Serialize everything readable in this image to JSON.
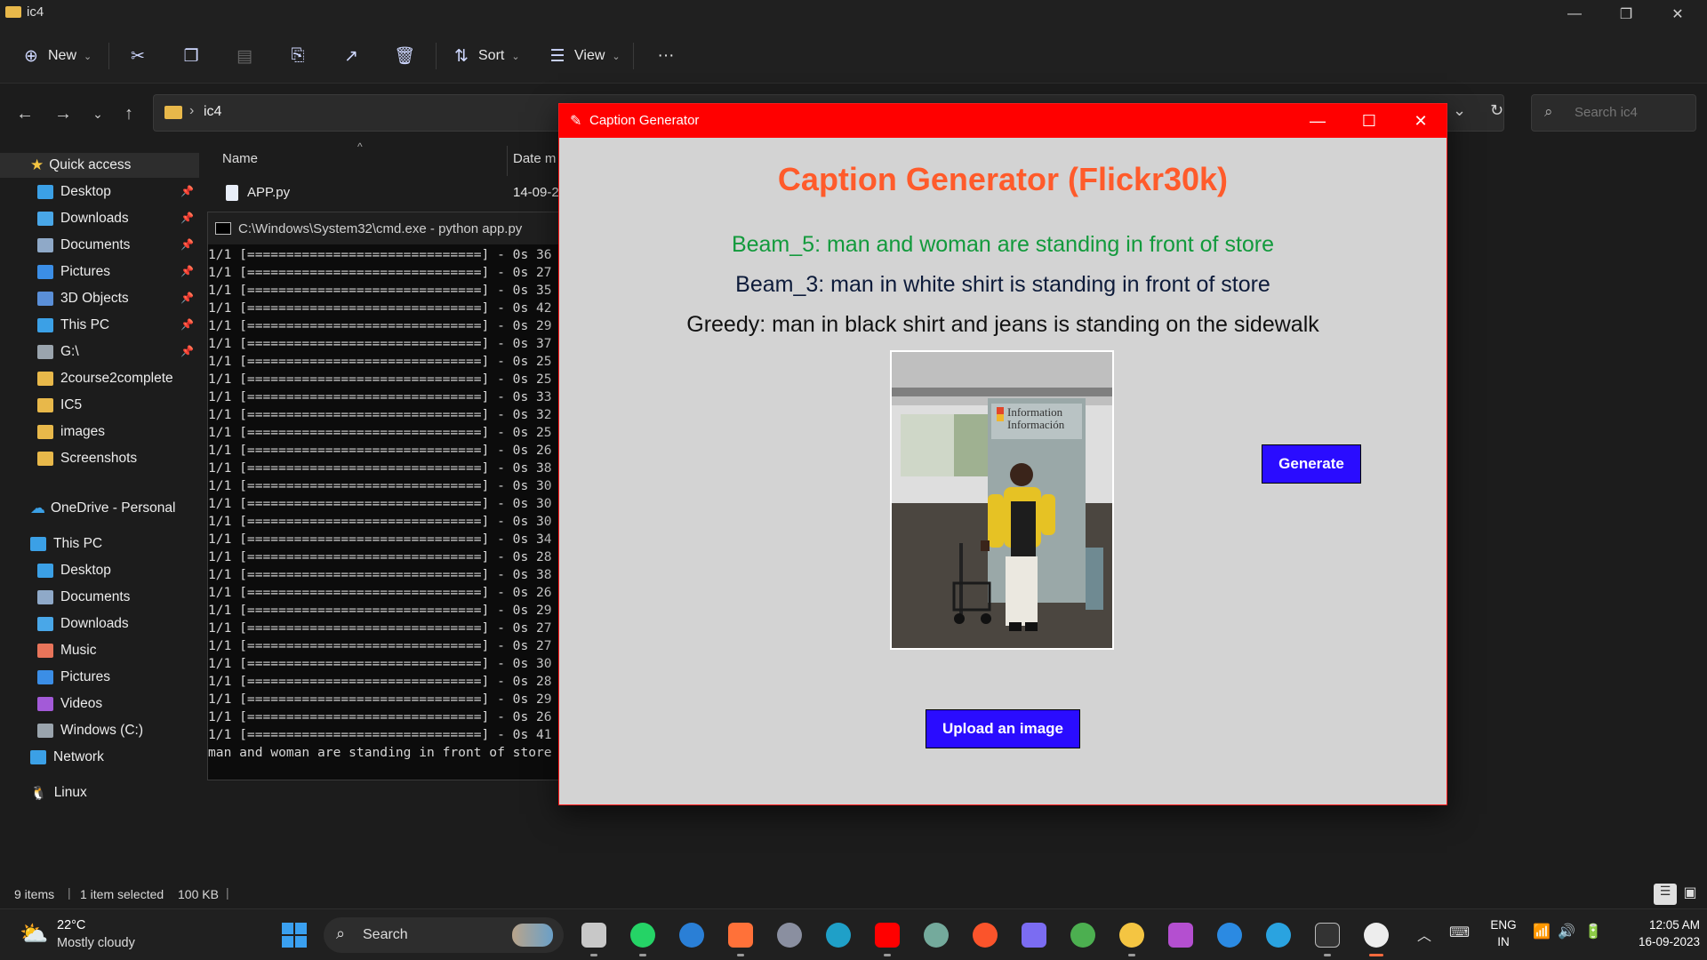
{
  "explorer": {
    "window_title": "ic4",
    "toolbar": {
      "new_label": "New",
      "sort_label": "Sort",
      "view_label": "View"
    },
    "address": {
      "path": "ic4",
      "search_placeholder": "Search ic4"
    },
    "sidebar": {
      "quick_access": "Quick access",
      "items": [
        {
          "label": "Desktop",
          "icon": "desktop-icon",
          "color": "#3ba0e6"
        },
        {
          "label": "Downloads",
          "icon": "download-icon",
          "color": "#49a7e8"
        },
        {
          "label": "Documents",
          "icon": "documents-icon",
          "color": "#8fa9c8"
        },
        {
          "label": "Pictures",
          "icon": "pictures-icon",
          "color": "#3b8ee6"
        },
        {
          "label": "3D Objects",
          "icon": "3d-objects-icon",
          "color": "#5a8fd8"
        },
        {
          "label": "This PC",
          "icon": "pc-icon",
          "color": "#3ba0e6"
        },
        {
          "label": "G:\\",
          "icon": "drive-icon",
          "color": "#9aa4ad"
        },
        {
          "label": "2course2complete",
          "icon": "folder-icon",
          "color": "#e8b84a"
        },
        {
          "label": "IC5",
          "icon": "folder-icon",
          "color": "#e8b84a"
        },
        {
          "label": "images",
          "icon": "folder-icon",
          "color": "#e8b84a"
        },
        {
          "label": "Screenshots",
          "icon": "folder-icon",
          "color": "#e8b84a"
        }
      ],
      "onedrive": "OneDrive - Personal",
      "this_pc": "This PC",
      "pc_items": [
        {
          "label": "Desktop",
          "icon": "desktop-icon",
          "color": "#3ba0e6"
        },
        {
          "label": "Documents",
          "icon": "documents-icon",
          "color": "#8fa9c8"
        },
        {
          "label": "Downloads",
          "icon": "download-icon",
          "color": "#49a7e8"
        },
        {
          "label": "Music",
          "icon": "music-icon",
          "color": "#e8745a"
        },
        {
          "label": "Pictures",
          "icon": "pictures-icon",
          "color": "#3b8ee6"
        },
        {
          "label": "Videos",
          "icon": "videos-icon",
          "color": "#a35ad8"
        },
        {
          "label": "Windows (C:)",
          "icon": "drive-icon",
          "color": "#9aa4ad"
        }
      ],
      "network": "Network",
      "linux": "Linux"
    },
    "filelist": {
      "col_name": "Name",
      "col_date": "Date m",
      "rows": [
        {
          "name": "APP.py",
          "date": "14-09-2"
        }
      ]
    },
    "status": {
      "items": "9 items",
      "selected": "1 item selected",
      "size": "100 KB"
    }
  },
  "cmd": {
    "title": "C:\\Windows\\System32\\cmd.exe - python  app.py",
    "lines": [
      "1/1 [==============================] - 0s 36",
      "1/1 [==============================] - 0s 27",
      "1/1 [==============================] - 0s 35",
      "1/1 [==============================] - 0s 42",
      "1/1 [==============================] - 0s 29",
      "1/1 [==============================] - 0s 37",
      "1/1 [==============================] - 0s 25",
      "1/1 [==============================] - 0s 25",
      "1/1 [==============================] - 0s 33",
      "1/1 [==============================] - 0s 32",
      "1/1 [==============================] - 0s 25",
      "1/1 [==============================] - 0s 26",
      "1/1 [==============================] - 0s 38",
      "1/1 [==============================] - 0s 30",
      "1/1 [==============================] - 0s 30",
      "1/1 [==============================] - 0s 30",
      "1/1 [==============================] - 0s 34",
      "1/1 [==============================] - 0s 28",
      "1/1 [==============================] - 0s 38",
      "1/1 [==============================] - 0s 26",
      "1/1 [==============================] - 0s 29",
      "1/1 [==============================] - 0s 27",
      "1/1 [==============================] - 0s 27",
      "1/1 [==============================] - 0s 30",
      "1/1 [==============================] - 0s 28",
      "1/1 [==============================] - 0s 29",
      "1/1 [==============================] - 0s 26",
      "1/1 [==============================] - 0s 41",
      "man and woman are standing in front of store"
    ]
  },
  "app": {
    "window_title": "Caption Generator",
    "heading": "Caption Generator (Flickr30k)",
    "beam5": "Beam_5: man and woman are standing in front of store",
    "beam3": "Beam_3: man in white shirt is standing in front of store",
    "greedy": "Greedy: man in black shirt and jeans is standing on the sidewalk",
    "photo_sign_1": "Information",
    "photo_sign_2": "Información",
    "generate_label": "Generate",
    "upload_label": "Upload an image",
    "colors": {
      "titlebar": "#ff0000",
      "heading": "#ff5b2b",
      "beam5": "#129a3c",
      "button": "#2a0cff"
    }
  },
  "taskbar": {
    "weather_temp": "22°C",
    "weather_desc": "Mostly cloudy",
    "search_label": "Search",
    "lang_top": "ENG",
    "lang_bottom": "IN",
    "time": "12:05 AM",
    "date": "16-09-2023",
    "apps": [
      "file-explorer-window-icon",
      "whatsapp-icon",
      "microsoft-store-icon",
      "firefox-icon",
      "settings-icon",
      "edge-icon",
      "youtube-icon",
      "chatgpt-icon",
      "brave-icon",
      "copilot-icon",
      "chrome-icon",
      "file-explorer-icon",
      "github-icon",
      "vscode-icon",
      "telegram-icon",
      "terminal-icon",
      "notepad-icon"
    ]
  }
}
